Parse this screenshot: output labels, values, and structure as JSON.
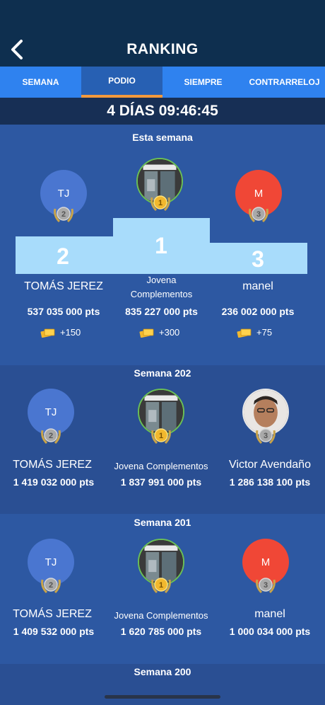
{
  "header": {
    "title": "RANKING"
  },
  "tabs": [
    {
      "label": "SEMANA"
    },
    {
      "label": "PODIO"
    },
    {
      "label": "SIEMPRE"
    },
    {
      "label": "CONTRARRELOJ"
    }
  ],
  "timer": "4 DÍAS 09:46:45",
  "this_week": {
    "title": "Esta semana",
    "second": {
      "initials": "TJ",
      "name": "TOMÁS JEREZ",
      "points": "537 035 000 pts",
      "reward": "+150",
      "place": "2"
    },
    "first": {
      "name_line1": "Jovena",
      "name_line2": "Complementos",
      "points": "835 227 000 pts",
      "reward": "+300",
      "place": "1"
    },
    "third": {
      "initials": "M",
      "name": "manel",
      "points": "236 002 000 pts",
      "reward": "+75",
      "place": "3"
    }
  },
  "week_202": {
    "title": "Semana 202",
    "second": {
      "initials": "TJ",
      "name": "TOMÁS JEREZ",
      "points": "1 419 032 000 pts"
    },
    "first": {
      "name": "Jovena Complementos",
      "points": "1 837 991 000 pts"
    },
    "third": {
      "name": "Victor Avendaño",
      "points": "1 286 138 100 pts"
    }
  },
  "week_201": {
    "title": "Semana 201",
    "second": {
      "initials": "TJ",
      "name": "TOMÁS JEREZ",
      "points": "1 409 532 000 pts"
    },
    "first": {
      "name": "Jovena Complementos",
      "points": "1 620 785 000 pts"
    },
    "third": {
      "initials": "M",
      "name": "manel",
      "points": "1 000 034 000 pts"
    }
  },
  "week_200": {
    "title": "Semana 200"
  },
  "colors": {
    "accent": "#f39a3d",
    "tab_bar": "#2f82ef",
    "header": "#0e2f4f",
    "podium": "#a8dcfb",
    "gold": "#f2b82e",
    "silver": "#a9a9a9",
    "bronze": "#c8a070"
  }
}
